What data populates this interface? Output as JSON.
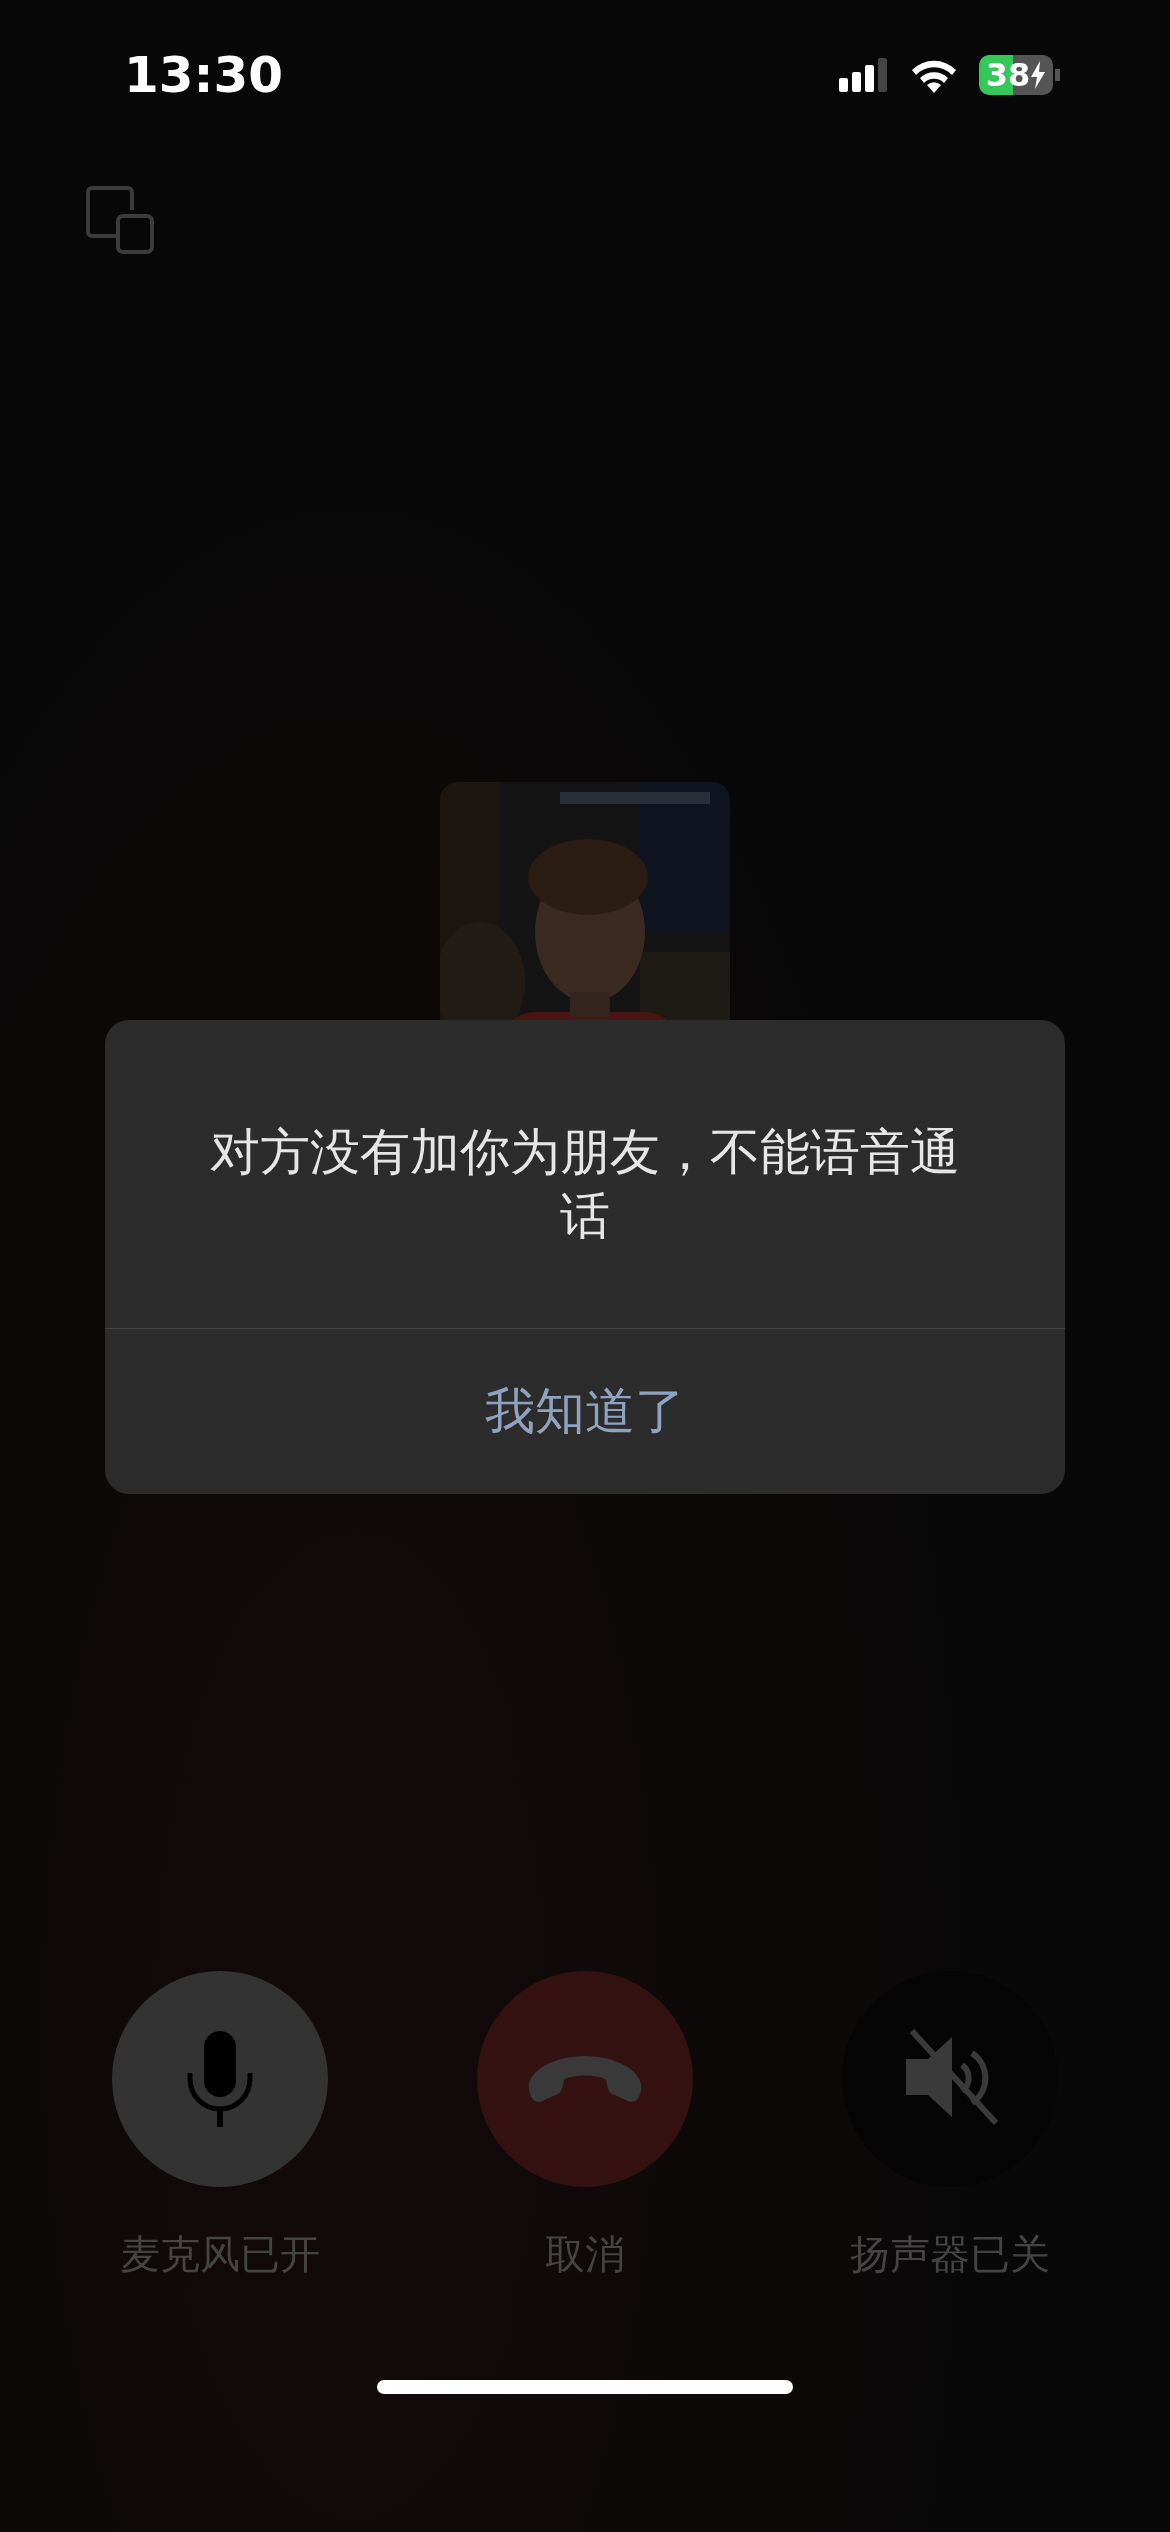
{
  "status_bar": {
    "time": "13:30",
    "battery": "38",
    "charging": true
  },
  "alert": {
    "message": "对方没有加你为朋友，不能语音通话",
    "button": "我知道了"
  },
  "controls": [
    {
      "kind": "mic",
      "label": "麦克风已开",
      "on": true
    },
    {
      "kind": "hangup",
      "label": "取消"
    },
    {
      "kind": "speaker",
      "label": "扬声器已关",
      "on": false
    }
  ]
}
